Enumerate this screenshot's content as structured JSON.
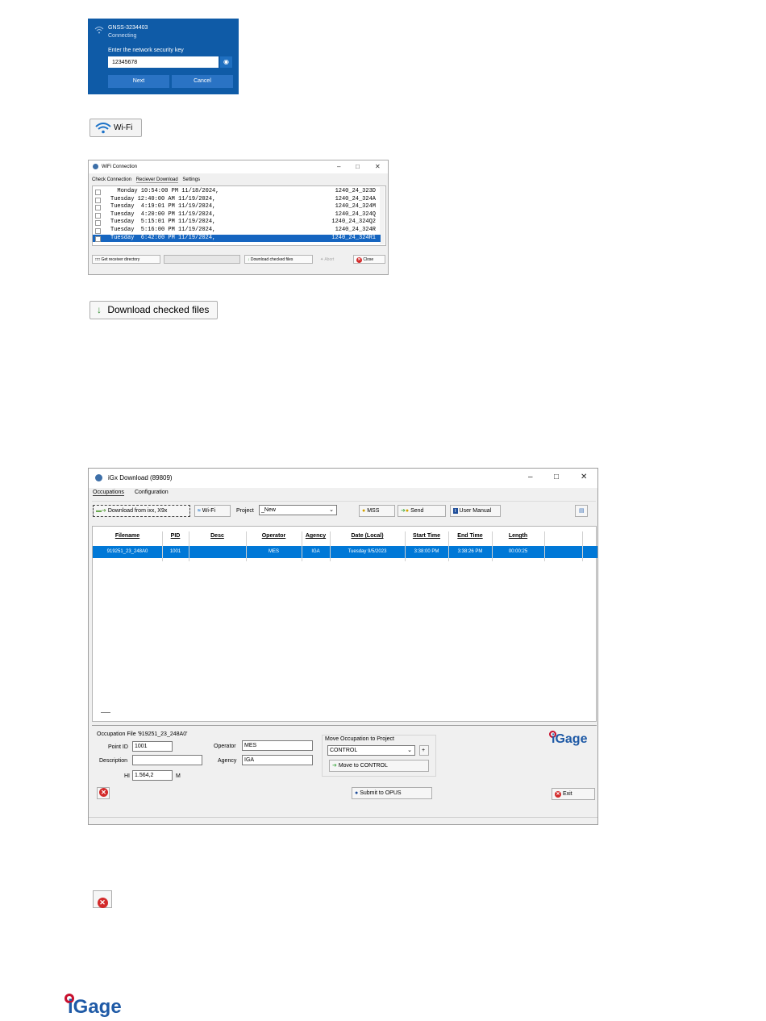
{
  "network_dialog": {
    "ssid": "GNSS-3234403",
    "status": "Connecting",
    "prompt": "Enter the network security key",
    "key_value": "12345678",
    "next_label": "Next",
    "cancel_label": "Cancel"
  },
  "wifi_button": {
    "label": "Wi-Fi"
  },
  "wifi_connection": {
    "title": "WiFi Connection",
    "tabs": [
      "Check Connection",
      "Reciever Download",
      "Settings"
    ],
    "files": [
      {
        "date": "  Monday 10:54:00 PM 11/18/2024,",
        "file": "1240_24_323D",
        "selected": false
      },
      {
        "date": "Tuesday 12:40:00 AM 11/19/2024,",
        "file": "1240_24_324A",
        "selected": false
      },
      {
        "date": "Tuesday  4:19:01 PM 11/19/2024,",
        "file": "1240_24_324M",
        "selected": false
      },
      {
        "date": "Tuesday  4:20:00 PM 11/19/2024,",
        "file": "1240_24_324Q",
        "selected": false
      },
      {
        "date": "Tuesday  5:15:01 PM 11/19/2024,",
        "file": "1240_24_324Q2",
        "selected": false
      },
      {
        "date": "Tuesday  5:16:00 PM 11/19/2024,",
        "file": "1240_24_324R",
        "selected": false
      },
      {
        "date": "Tuesday  6:42:00 PM 11/19/2024,",
        "file": "1240_24_324R1",
        "selected": true
      }
    ],
    "get_dir_label": "Get receiver directory",
    "download_label": "Download checked files",
    "abort_label": "Abort",
    "close_label": "Close"
  },
  "download_button": {
    "label": "Download checked files"
  },
  "igx": {
    "title": "iGx Download  (89809)",
    "tabs": [
      "Occupations",
      "Configuration"
    ],
    "toolbar": {
      "download_label": "Download from ixx, X9x",
      "wifi_label": "Wi-Fi",
      "project_label": "Project",
      "project_value": "_New",
      "mss_label": "MSS",
      "send_label": "Send",
      "manual_label": "User Manual"
    },
    "columns": [
      "Filename",
      "PID",
      "Desc",
      "Operator",
      "Agency",
      "Date (Local)",
      "Start Time",
      "End Time",
      "Length"
    ],
    "rows": [
      [
        "919251_23_248A0",
        "1001",
        "",
        "MES",
        "IGA",
        "Tuesday 9/5/2023",
        "3:38:00 PM",
        "3:38:26 PM",
        "00:00:25"
      ]
    ],
    "occupation": {
      "file_label": "Occupation File '919251_23_248A0'",
      "point_id_label": "Point ID",
      "point_id": "1001",
      "description_label": "Description",
      "description": "",
      "hi_label": "HI",
      "hi_value": "1.564,2",
      "hi_unit": "M",
      "operator_label": "Operator",
      "operator": "MES",
      "agency_label": "Agency",
      "agency": "IGA"
    },
    "move": {
      "group_label": "Move Occupation to Project",
      "project": "CONTROL",
      "plus": "+",
      "button": "Move to CONTROL"
    },
    "submit_label": "Submit to OPUS",
    "exit_label": "Exit",
    "logo_text": "iGage"
  },
  "footer_logo": "iGage",
  "colors": {
    "dialog_blue": "#0f5ba7",
    "selection_blue": "#0078d7",
    "logo_red": "#c8102e",
    "logo_blue": "#1f5aa6"
  }
}
